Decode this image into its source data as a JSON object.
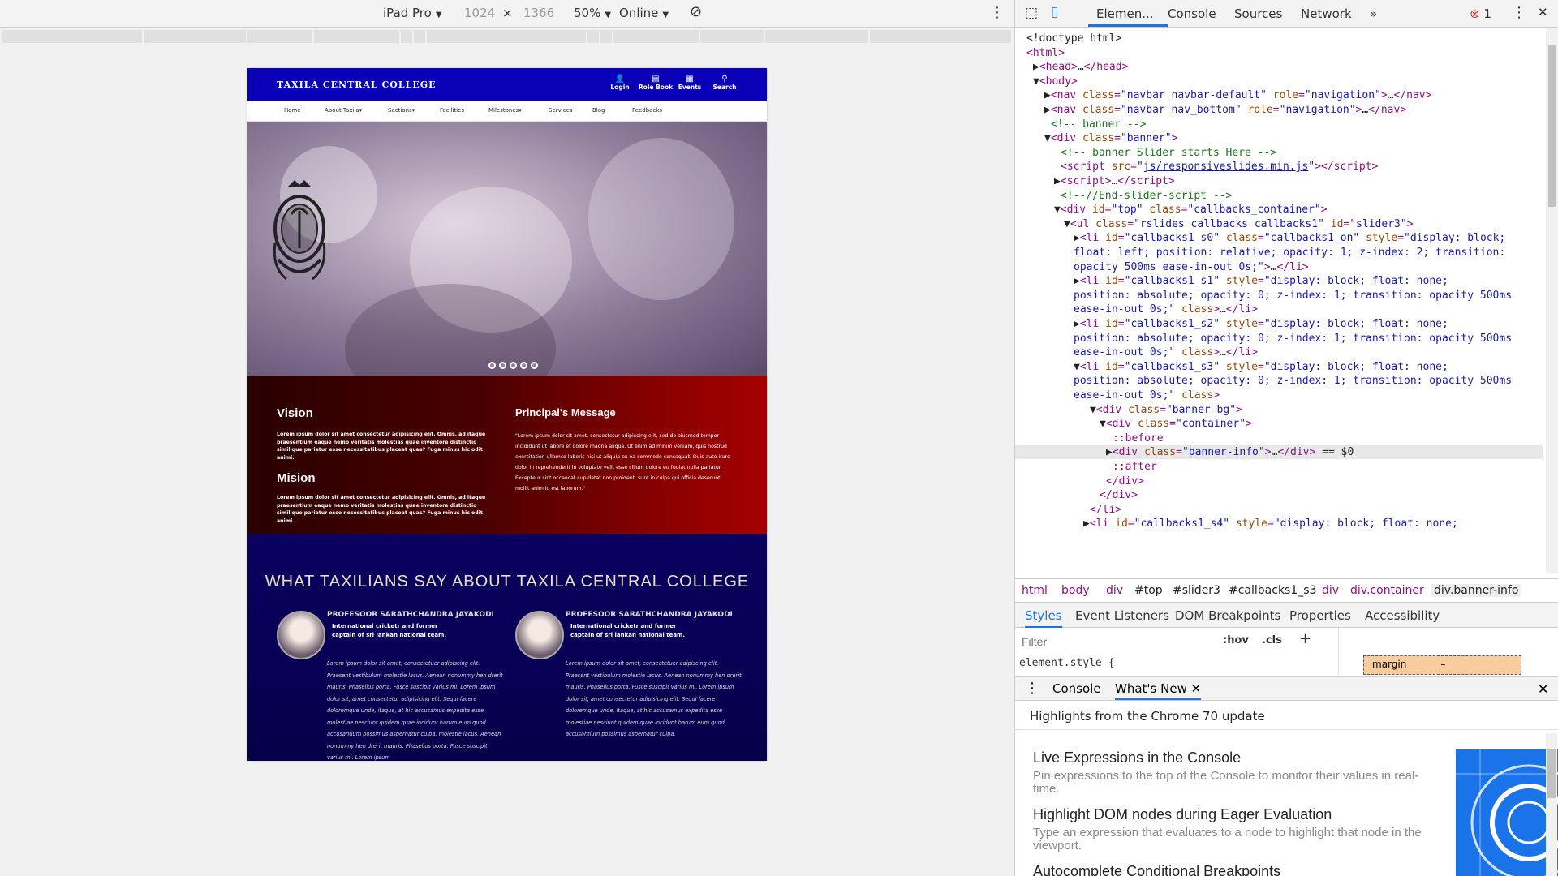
{
  "emulator": {
    "device": "iPad Pro",
    "width": "1024",
    "times": "×",
    "height": "1366",
    "zoom": "50%",
    "network": "Online",
    "more_icon": "kebab-menu-icon",
    "rotate_icon": "rotate-icon"
  },
  "site": {
    "title": "TAXILA CENTRAL COLLEGE",
    "top_icons": [
      {
        "label": "Login",
        "glyph": "👤"
      },
      {
        "label": "Role Book",
        "glyph": "▤"
      },
      {
        "label": "Events",
        "glyph": "▦"
      },
      {
        "label": "Search",
        "glyph": "⚲"
      }
    ],
    "menu": [
      "Home",
      "About Taxila▾",
      "Sections▾",
      "Facilities",
      "Milestones▾",
      "Services",
      "Blog",
      "Feedbacks"
    ],
    "vision_title": "Vision",
    "vision_text": "Lorem ipsum dolor sit amet consectetur adipisicing elit. Omnis, ad itaque praesentium eaque nemo veritatis molestias quae inventore distinctio similique pariatur esse necessitatibus placeat quas? Fuga minus hic odit animi.",
    "mission_title": "Mision",
    "mission_text": "Lorem ipsum dolor sit amet consectetur adipisicing elit. Omnis, ad itaque praesentium eaque nemo veritatis molestias quae inventore distinctio similique pariatur esse necessitatibus placeat quas? Fuga minus hic odit animi.",
    "principal_title": "Principal's Message",
    "principal_text": "\"Lorem ipsum dolor sit amet, consectetur adipiscing elit, sed do eiusmod tempor incididunt ut labore et dolore magna aliqua. Ut enim ad minim veniam, quis nostrud exercitation ullamco laboris nisi ut aliquip ex ea commodo consequat. Duis aute irure dolor in reprehenderit in voluptate velit esse cillum dolore eu fugiat nulla pariatur. Excepteur sint occaecat cupidatat non proident, sunt in culpa qui officia deserunt mollit anim id est laborum.\"",
    "testimonials_title": "WHAT TAXILIANS SAY ABOUT TAXILA CENTRAL COLLEGE",
    "testimonials": [
      {
        "name": "PROFESOOR SARATHCHANDRA JAYAKODI",
        "role": "International cricketr and former captain of sri lankan national team.",
        "quote": "Lorem ipsum dolor sit amet, consectetuer adipiscing elit. Praesent vestibulum molestie lacus. Aenean nonummy hen drerit mauris. Phasellus porta. Fusce suscipit varius mi. Lorem ipsum dolor sit, amet consectetur adipisicing elit. Sequi facere doloremque unde, itaque, at hic accusamus expedita esse molestiae nesciunt quidem quae incidunt harum eum quod accusantium possimus aspernatur culpa. molestie lacus. Aenean nonummy hen drerit mauris. Phasellus porta. Fusce suscipit varius mi. Lorem ipsum"
      },
      {
        "name": "PROFESOOR SARATHCHANDRA JAYAKODI",
        "role": "International cricketr and former captain of sri lankan national team.",
        "quote": "Lorem ipsum dolor sit amet, consectetuer adipiscing elit. Praesent vestibulum molestie lacus. Aenean nonummy hen drerit mauris. Phasellus porta. Fusce suscipit varius mi. Lorem ipsum dolor sit, amet consectetur adipisicing elit. Sequi facere doloremque unde, itaque, at hic accusamus expedita esse molestiae nesciunt quidem quae incidunt harum eum quod accusantium possimus aspernatur culpa."
      }
    ],
    "slide_dots": 5
  },
  "devtools": {
    "tabs": [
      "Elemen...",
      "Console",
      "Sources",
      "Network",
      "»"
    ],
    "error_count": "1",
    "breadcrumb": [
      "html",
      "body",
      "div",
      "#top",
      "#slider3",
      "#callbacks1_s3",
      "div",
      "div.container",
      "div.banner-info"
    ],
    "styles_tabs": [
      "Styles",
      "Event Listeners",
      "DOM Breakpoints",
      "Properties",
      "Accessibility"
    ],
    "filter_placeholder": "Filter",
    "hov": ":hov",
    "cls": ".cls",
    "element_style": "element.style {",
    "box_margin": "margin",
    "box_dash": "–",
    "drawer_tabs": [
      "Console",
      "What's New"
    ],
    "whats_new_header": "Highlights from the Chrome 70 update",
    "whats_new": [
      {
        "title": "Live Expressions in the Console",
        "desc": "Pin expressions to the top of the Console to monitor their values in real-time."
      },
      {
        "title": "Highlight DOM nodes during Eager Evaluation",
        "desc": "Type an expression that evaluates to a node to highlight that node in the viewport."
      },
      {
        "title": "Autocomplete Conditional Breakpoints",
        "desc": ""
      }
    ],
    "dom_lines": [
      {
        "html": "<span class='tx'>&lt;!doctype html&gt;</span>"
      },
      {
        "html": "<span class='tg'>&lt;html&gt;</span>"
      },
      {
        "html": "<span class='tx'>▶</span><span class='tg'>&lt;head&gt;</span><span class='tx'>…</span><span class='tg'>&lt;/head&gt;</span>"
      },
      {
        "html": "<span class='tx'>▼</span><span class='tg'>&lt;body&gt;</span>"
      },
      {
        "html": "<span class='tx'>▶</span><span class='tg'>&lt;nav </span><span class='at'>class</span>=<span class='av'>\"navbar navbar-default\"</span> <span class='at'>role</span>=<span class='av'>\"navigation\"</span><span class='tg'>&gt;</span><span class='tx'>…</span><span class='tg'>&lt;/nav&gt;</span>"
      },
      {
        "html": "<span class='tx'>▶</span><span class='tg'>&lt;nav </span><span class='at'>class</span>=<span class='av'>\"navbar nav_bottom\"</span> <span class='at'>role</span>=<span class='av'>\"navigation\"</span><span class='tg'>&gt;</span><span class='tx'>…</span><span class='tg'>&lt;/nav&gt;</span>"
      },
      {
        "html": "<span class='cm'>&lt;!-- banner --&gt;</span>"
      },
      {
        "html": "<span class='tx'>▼</span><span class='tg'>&lt;div </span><span class='at'>class</span>=<span class='av'>\"banner\"</span><span class='tg'>&gt;</span>"
      },
      {
        "html": "<span class='cm'>&lt;!-- banner Slider starts Here --&gt;</span>"
      },
      {
        "html": "<span class='tg'>&lt;script </span><span class='at'>src</span>=<span class='av'>\"</span><span class='lk'>js/responsiveslides.min.js</span><span class='av'>\"</span><span class='tg'>&gt;&lt;/script&gt;</span>"
      },
      {
        "html": "<span class='tx'>▶</span><span class='tg'>&lt;script&gt;</span><span class='tx'>…</span><span class='tg'>&lt;/script&gt;</span>"
      },
      {
        "html": "<span class='cm'>&lt;!--//End-slider-script --&gt;</span>"
      },
      {
        "html": "<span class='tx'>▼</span><span class='tg'>&lt;div </span><span class='at'>id</span>=<span class='av'>\"top\"</span> <span class='at'>class</span>=<span class='av'>\"callbacks_container\"</span><span class='tg'>&gt;</span>"
      },
      {
        "html": "<span class='tx'>▼</span><span class='tg'>&lt;ul </span><span class='at'>class</span>=<span class='av'>\"rslides callbacks callbacks1\"</span> <span class='at'>id</span>=<span class='av'>\"slider3\"</span><span class='tg'>&gt;</span>"
      },
      {
        "html": "<span class='tx'>▶</span><span class='tg'>&lt;li </span><span class='at'>id</span>=<span class='av'>\"callbacks1_s0\"</span> <span class='at'>class</span>=<span class='av'>\"callbacks1_on\"</span> <span class='at'>style</span>=<span class='av'>\"display: block;</span>"
      },
      {
        "html": "<span class='av'>float: left; position: relative; opacity: 1; z-index: 2; transition:</span>"
      },
      {
        "html": "<span class='av'>opacity 500ms ease-in-out 0s;\"</span><span class='tg'>&gt;</span><span class='tx'>…</span><span class='tg'>&lt;/li&gt;</span>"
      },
      {
        "html": "<span class='tx'>▶</span><span class='tg'>&lt;li </span><span class='at'>id</span>=<span class='av'>\"callbacks1_s1\"</span> <span class='at'>style</span>=<span class='av'>\"display: block; float: none;</span>"
      },
      {
        "html": "<span class='av'>position: absolute; opacity: 0; z-index: 1; transition: opacity 500ms</span>"
      },
      {
        "html": "<span class='av'>ease-in-out 0s;\"</span> <span class='at'>class</span><span class='tg'>&gt;</span><span class='tx'>…</span><span class='tg'>&lt;/li&gt;</span>"
      },
      {
        "html": "<span class='tx'>▶</span><span class='tg'>&lt;li </span><span class='at'>id</span>=<span class='av'>\"callbacks1_s2\"</span> <span class='at'>style</span>=<span class='av'>\"display: block; float: none;</span>"
      },
      {
        "html": "<span class='av'>position: absolute; opacity: 0; z-index: 1; transition: opacity 500ms</span>"
      },
      {
        "html": "<span class='av'>ease-in-out 0s;\"</span> <span class='at'>class</span><span class='tg'>&gt;</span><span class='tx'>…</span><span class='tg'>&lt;/li&gt;</span>"
      },
      {
        "html": "<span class='tx'>▼</span><span class='tg'>&lt;li </span><span class='at'>id</span>=<span class='av'>\"callbacks1_s3\"</span> <span class='at'>style</span>=<span class='av'>\"display: block; float: none;</span>"
      },
      {
        "html": "<span class='av'>position: absolute; opacity: 0; z-index: 1; transition: opacity 500ms</span>"
      },
      {
        "html": "<span class='av'>ease-in-out 0s;\"</span> <span class='at'>class</span><span class='tg'>&gt;</span>"
      },
      {
        "html": "<span class='tx'>▼</span><span class='tg'>&lt;div </span><span class='at'>class</span>=<span class='av'>\"banner-bg\"</span><span class='tg'>&gt;</span>"
      },
      {
        "html": "<span class='tx'>▼</span><span class='tg'>&lt;div </span><span class='at'>class</span>=<span class='av'>\"container\"</span><span class='tg'>&gt;</span>"
      },
      {
        "html": "<span class='tg'>::before</span>"
      },
      {
        "html": "<span class='tx'>▶</span><span class='tg'>&lt;div </span><span class='at'>class</span>=<span class='av'>\"banner-info\"</span><span class='tg'>&gt;</span><span class='tx'>…</span><span class='tg'>&lt;/div&gt;</span> <span class='tx'>== $0</span>"
      },
      {
        "html": "<span class='tg'>::after</span>"
      },
      {
        "html": "<span class='tg'>&lt;/div&gt;</span>"
      },
      {
        "html": "<span class='tg'>&lt;/div&gt;</span>"
      },
      {
        "html": "<span class='tg'>&lt;/li&gt;</span>"
      },
      {
        "html": "<span class='tx'>▶</span><span class='tg'>&lt;li </span><span class='at'>id</span>=<span class='av'>\"callbacks1_s4\"</span> <span class='at'>style</span>=<span class='av'>\"display: block; float: none;</span>"
      }
    ]
  }
}
